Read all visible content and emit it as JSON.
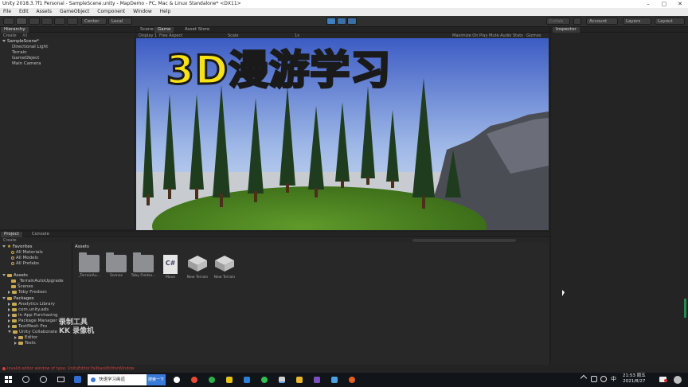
{
  "window": {
    "title": "Unity 2018.3.7f1 Personal - SampleScene.unity - MapDemo - PC, Mac & Linux Standalone* <DX11>"
  },
  "menu": [
    "File",
    "Edit",
    "Assets",
    "GameObject",
    "Component",
    "Window",
    "Help"
  ],
  "toolbar": {
    "center": "Center",
    "local": "Local",
    "account": "Account",
    "layers": "Layers",
    "layout": "Layout",
    "collab": "Collab"
  },
  "hierarchy": {
    "tab": "Hierarchy",
    "create": "Create",
    "all": "All",
    "scene": "SampleScene*",
    "items": [
      "Directional Light",
      "Terrain",
      "GameObject",
      "Main Camera"
    ]
  },
  "game": {
    "tabs": [
      "Scene",
      "Game",
      "Asset Store"
    ],
    "display": "Display 1",
    "aspect": "Free Aspect",
    "scale_label": "Scale",
    "scale_value": "1x",
    "maximize": "Maximize On Play",
    "mute": "Mute Audio",
    "stats": "Stats",
    "gizmos": "Gizmos",
    "overlay_title": "3D漫游学习"
  },
  "inspector": {
    "tab": "Inspector"
  },
  "project": {
    "tabs": [
      "Project",
      "Console"
    ],
    "create": "Create",
    "favorites": "Favorites",
    "fav_items": [
      "All Materials",
      "All Models",
      "All Prefabs"
    ],
    "assets": "Assets",
    "asset_tree": [
      "_TerrainAutoUpgrade",
      "Scenes",
      "Toby Fredson"
    ],
    "packages": "Packages",
    "package_items": [
      "Analytics Library",
      "com.unity.ads",
      "In App Purchasing",
      "Package Manager UI",
      "TextMesh Pro",
      "Unity Collaborate"
    ],
    "collab_children": [
      "Editor",
      "Tests"
    ],
    "breadcrumb": "Assets",
    "grid": [
      {
        "label": "_TerrainAu...",
        "kind": "folder"
      },
      {
        "label": "Scenes",
        "kind": "folder"
      },
      {
        "label": "Toby Fredso...",
        "kind": "folder"
      },
      {
        "label": "Move",
        "kind": "cs"
      },
      {
        "label": "New Terrain",
        "kind": "terrain"
      },
      {
        "label": "New Terrain",
        "kind": "terrain"
      }
    ]
  },
  "status": {
    "text": "Invalid editor window of type: UnityEditor.FallbackEditorWindow"
  },
  "watermark": {
    "line1": "录制工具",
    "line2": "KK 录像机"
  },
  "taskbar": {
    "search_text": "快速学习画道",
    "search_button": "搜索一下",
    "time": "21:53 周五",
    "date": "2021/8/27",
    "ime": "中"
  },
  "colors": {
    "title_yellow": "#f7e21a",
    "accent_blue": "#3f7fbf",
    "panel": "#282828"
  }
}
